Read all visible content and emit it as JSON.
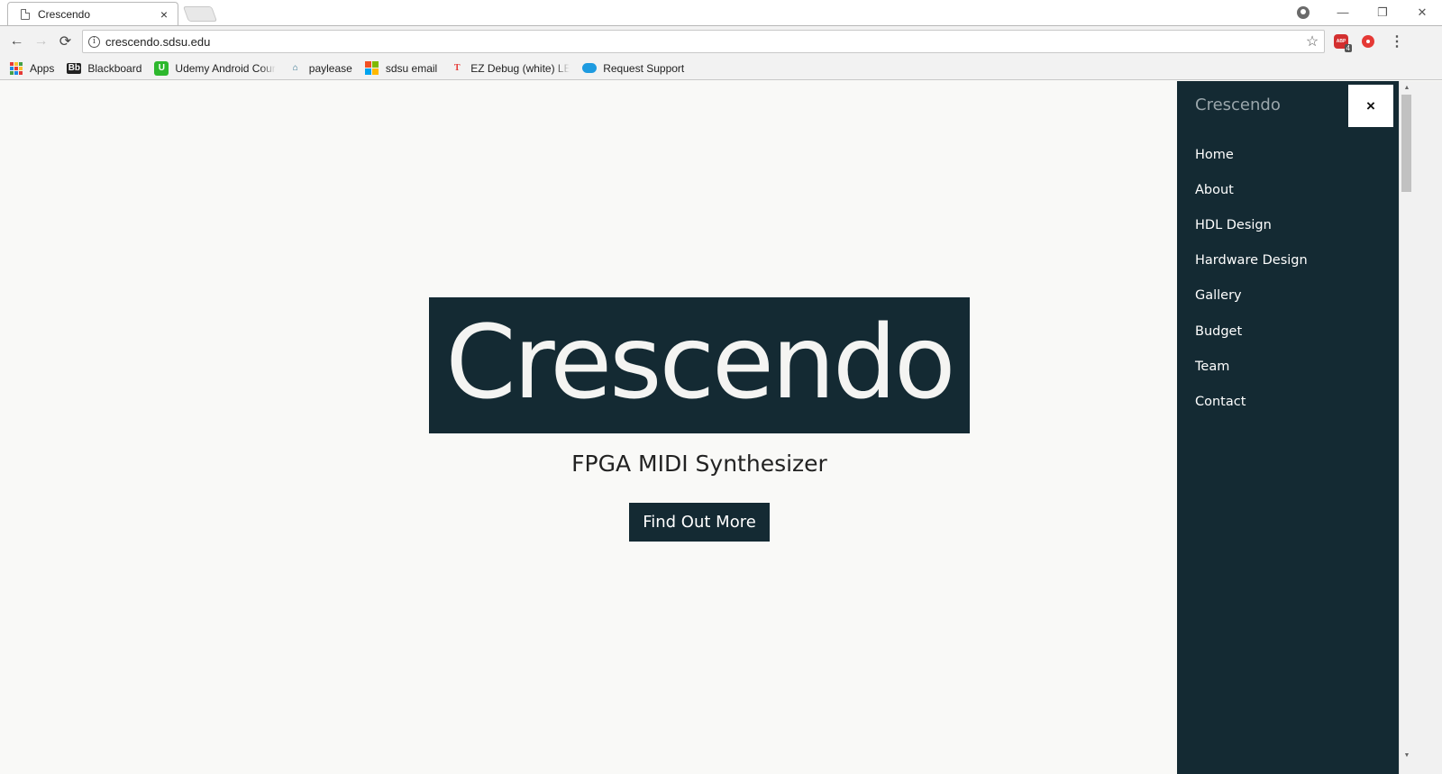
{
  "browser": {
    "tab_title": "Crescendo",
    "tab_close": "×",
    "url": "crescendo.sdsu.edu",
    "win_min": "—",
    "win_restore": "❐",
    "win_close": "✕",
    "back": "←",
    "forward": "→",
    "reload": "⟳",
    "star": "☆",
    "menu": "⋮",
    "abp_label": "ABP",
    "abp_badge": "4"
  },
  "bookmarks": [
    {
      "label": "Apps",
      "icon": "apps-grid-icon"
    },
    {
      "label": "Blackboard",
      "icon": "blackboard-icon",
      "glyph": "Bb"
    },
    {
      "label": "Udemy Android Cour",
      "icon": "udemy-icon",
      "glyph": "U"
    },
    {
      "label": "paylease",
      "icon": "house-icon",
      "glyph": "⌂"
    },
    {
      "label": "sdsu email",
      "icon": "microsoft-icon"
    },
    {
      "label": "EZ Debug (white) LED",
      "icon": "tesla-icon",
      "glyph": "T"
    },
    {
      "label": "Request Support",
      "icon": "salesforce-cloud-icon"
    }
  ],
  "hero": {
    "logo_text": "Crescendo",
    "tagline": "FPGA MIDI Synthesizer",
    "cta_label": "Find Out More"
  },
  "sidenav": {
    "brand": "Crescendo",
    "close_label": "×",
    "items": [
      "Home",
      "About",
      "HDL Design",
      "Hardware Design",
      "Gallery",
      "Budget",
      "Team",
      "Contact"
    ]
  },
  "scrollbar": {
    "up": "▲",
    "down": "▼"
  },
  "colors": {
    "brand_dark": "#142a33",
    "page_bg": "#f9f9f7",
    "nav_text": "#ffffff",
    "brand_muted": "#9aa6ab"
  }
}
